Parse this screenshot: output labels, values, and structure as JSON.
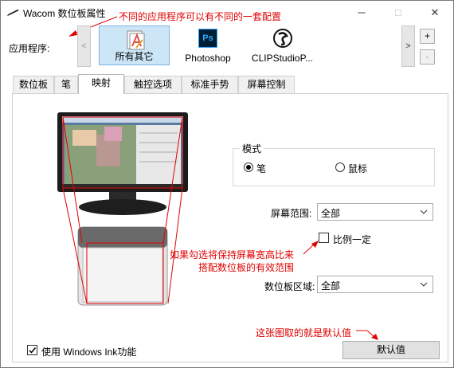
{
  "window": {
    "title": "Wacom 数位板属性",
    "minimize": "─",
    "maximize": "□",
    "close": "✕"
  },
  "annotations": {
    "config_note": "不同的应用程序可以有不同的一套配置",
    "ratio_note_line1": "如果勾选将保持屏幕宽高比来",
    "ratio_note_line2": "搭配数位板的有效范围",
    "default_note": "这张图取的就是默认值"
  },
  "apps": {
    "label": "应用程序:",
    "items": [
      {
        "label": "所有其它",
        "selected": true,
        "icon": "all-other-apps-icon"
      },
      {
        "label": "Photoshop",
        "selected": false,
        "icon": "photoshop-icon",
        "icon_text": "Ps"
      },
      {
        "label": "CLIPStudioP...",
        "selected": false,
        "icon": "clip-studio-icon"
      }
    ],
    "scroll_left": "<",
    "scroll_right": ">",
    "add": "+",
    "remove": "-"
  },
  "tabs": [
    {
      "label": "数位板",
      "active": false
    },
    {
      "label": "笔",
      "active": false
    },
    {
      "label": "映射",
      "active": true
    },
    {
      "label": "触控选项",
      "active": false
    },
    {
      "label": "标准手势",
      "active": false
    },
    {
      "label": "屏幕控制",
      "active": false
    }
  ],
  "mapping": {
    "mode_group_title": "模式",
    "mode_pen": "笔",
    "mode_mouse": "鼠标",
    "mode_selected": "pen",
    "screen_area_label": "屏幕范围:",
    "screen_area_value": "全部",
    "keep_ratio_label": "比例一定",
    "keep_ratio_checked": false,
    "tablet_area_label": "数位板区域:",
    "tablet_area_value": "全部",
    "windows_ink_label": "使用 Windows Ink功能",
    "windows_ink_checked": true,
    "default_button": "默认值"
  },
  "colors": {
    "annotation_red": "#e00000",
    "selected_app_bg": "#cde6f7",
    "ps_blue": "#001e36",
    "ps_text": "#31a8ff"
  }
}
